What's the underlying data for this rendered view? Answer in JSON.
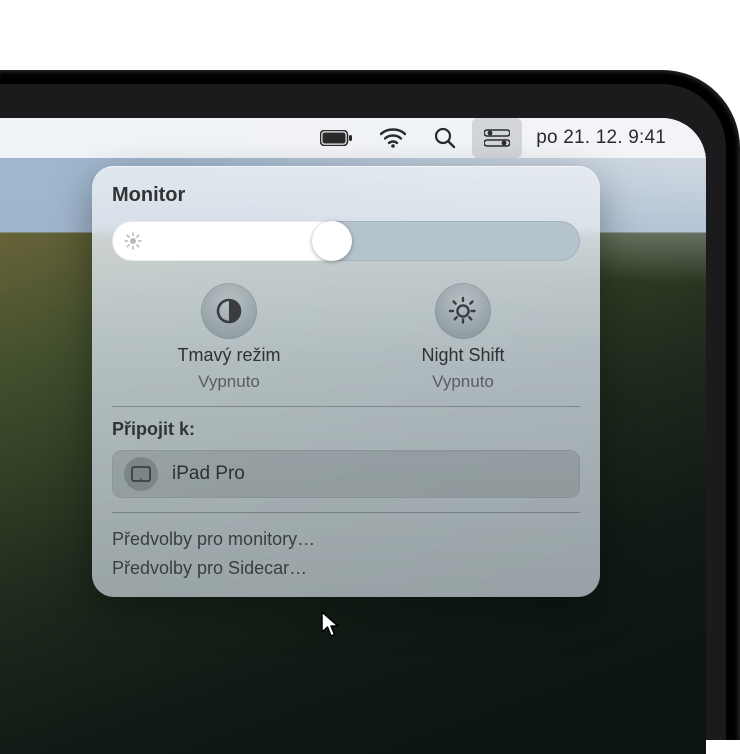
{
  "menubar": {
    "clock": "po 21. 12.  9:41"
  },
  "panel": {
    "title": "Monitor",
    "brightness_percent": 47,
    "toggles": {
      "dark_mode": {
        "label": "Tmavý režim",
        "state": "Vypnuto"
      },
      "night_shift": {
        "label": "Night Shift",
        "state": "Vypnuto"
      }
    },
    "connect_label": "Připojit k:",
    "devices": [
      {
        "name": "iPad Pro"
      }
    ],
    "links": {
      "display_prefs": "Předvolby pro monitory…",
      "sidecar_prefs": "Předvolby pro Sidecar…"
    }
  }
}
